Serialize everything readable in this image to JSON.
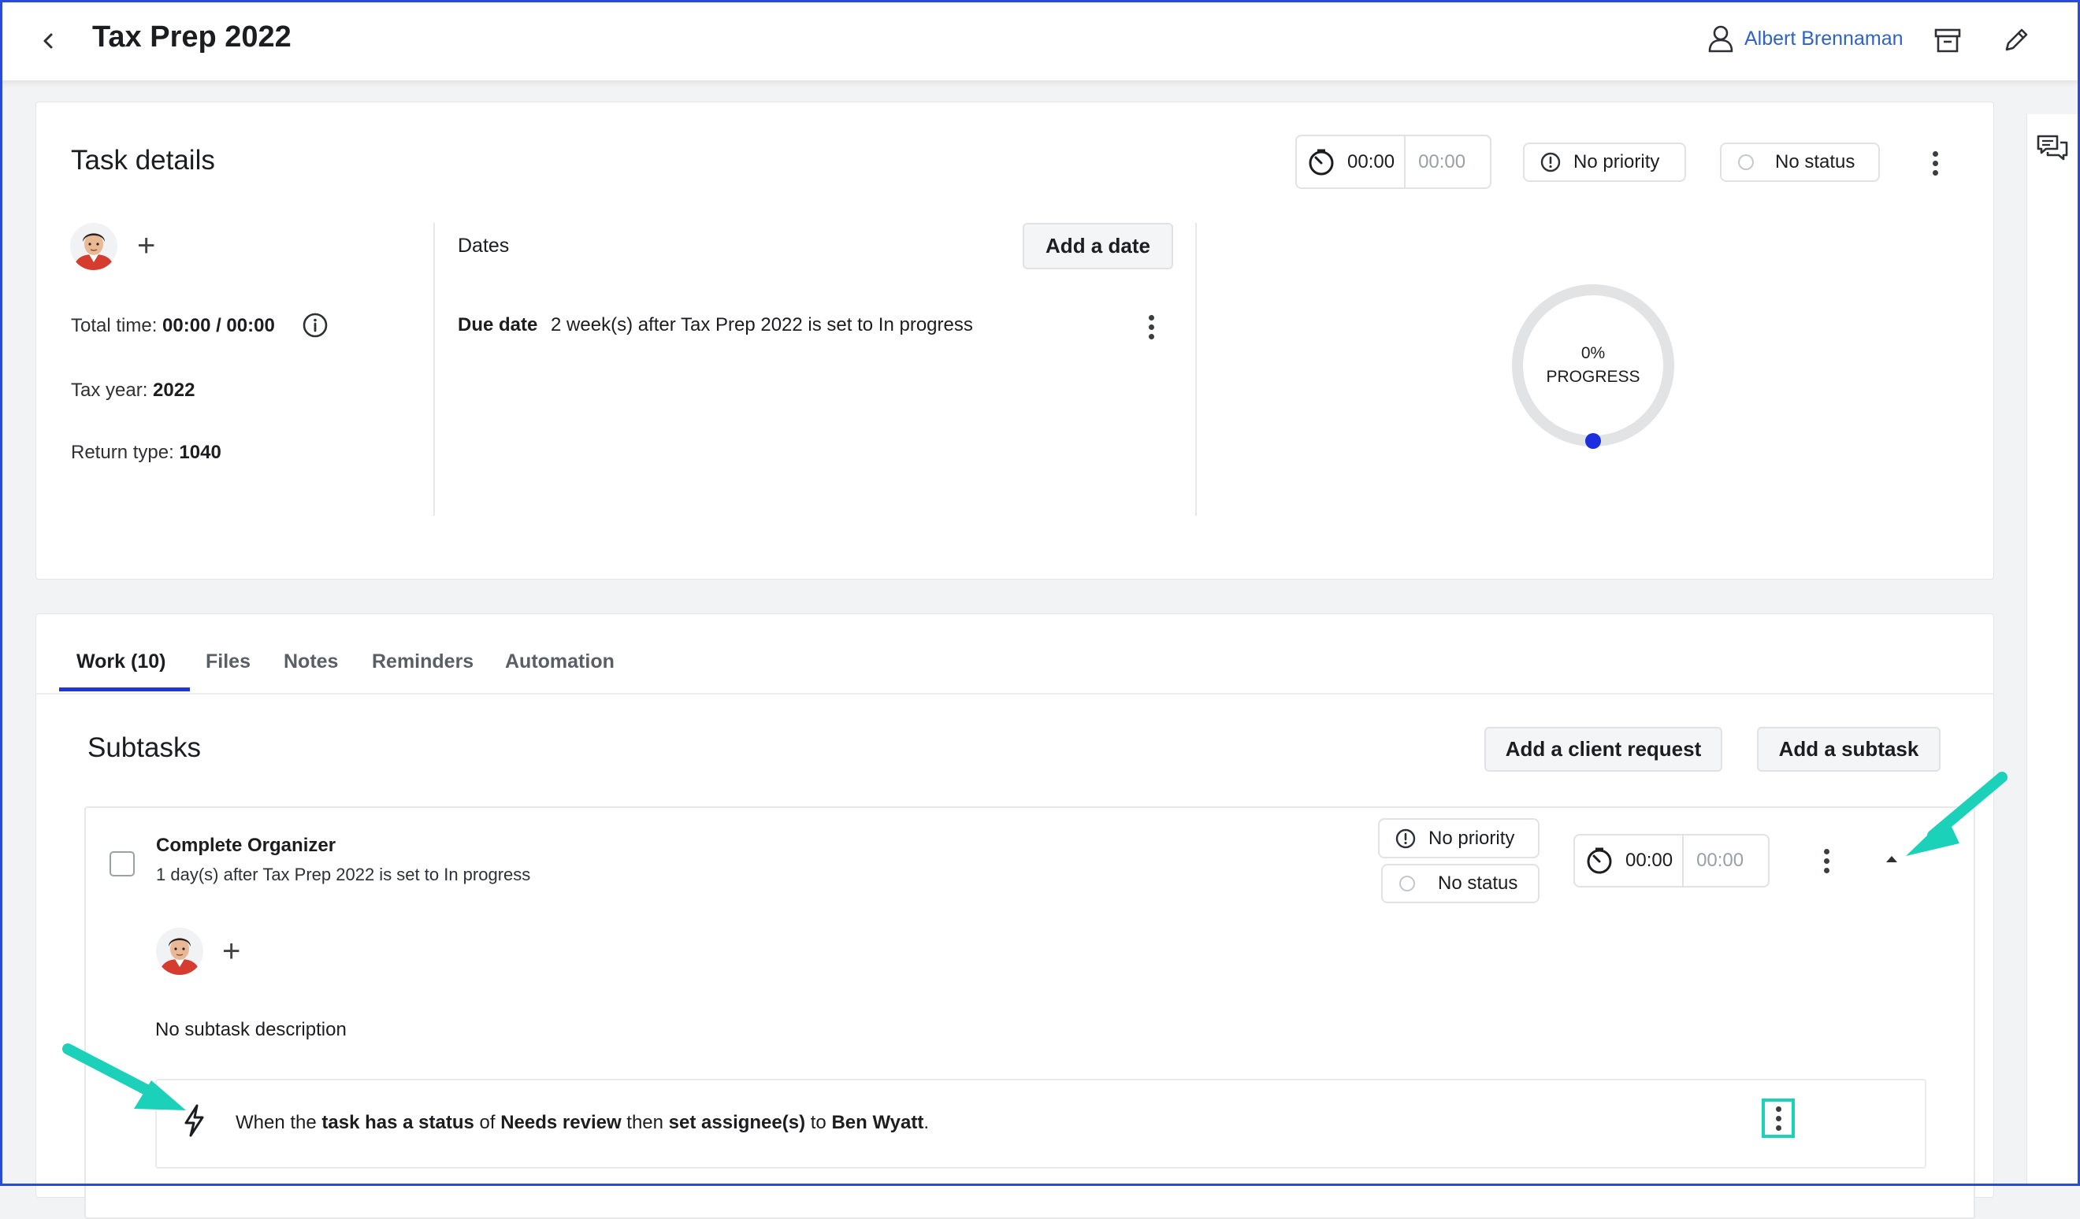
{
  "header": {
    "title": "Tax Prep 2022",
    "user_name": "Albert Brennaman"
  },
  "task_details": {
    "title": "Task details",
    "timer": {
      "elapsed": "00:00",
      "estimate": "00:00"
    },
    "priority": "No priority",
    "status": "No status",
    "total_time_label": "Total time:",
    "total_time_value": "00:00 / 00:00",
    "tax_year_label": "Tax year:",
    "tax_year_value": "2022",
    "return_type_label": "Return type:",
    "return_type_value": "1040",
    "dates_label": "Dates",
    "add_date_label": "Add a date",
    "due_date_label": "Due date",
    "due_date_value": "2 week(s) after Tax Prep 2022 is set to In progress",
    "progress": {
      "value": 0,
      "percent_label": "0%",
      "label": "PROGRESS"
    }
  },
  "tabs": [
    {
      "label": "Work  (10)",
      "active": true
    },
    {
      "label": "Files",
      "active": false
    },
    {
      "label": "Notes",
      "active": false
    },
    {
      "label": "Reminders",
      "active": false
    },
    {
      "label": "Automation",
      "active": false
    }
  ],
  "subtasks": {
    "title": "Subtasks",
    "add_client_request_label": "Add a client request",
    "add_subtask_label": "Add a subtask",
    "item": {
      "title": "Complete Organizer",
      "subtitle": "1 day(s) after Tax Prep 2022 is set to In progress",
      "priority": "No priority",
      "status": "No status",
      "timer": {
        "elapsed": "00:00",
        "estimate": "00:00"
      },
      "description": "No subtask description",
      "automation": {
        "p1": "When the ",
        "b1": "task has a status",
        "p2": " of ",
        "b2": "Needs review",
        "p3": " then ",
        "b3": "set assignee(s)",
        "p4": " to ",
        "b4": "Ben Wyatt",
        "p5": "."
      }
    }
  },
  "colors": {
    "accent": "#2235d4",
    "link": "#2f62c6",
    "annotation_arrow": "#1cd1b9",
    "frame": "#2a4bd7"
  },
  "icons": [
    "back-chevron-icon",
    "user-icon",
    "archive-icon",
    "pencil-icon",
    "comments-icon",
    "timer-icon",
    "priority-icon",
    "status-circle-icon",
    "info-icon",
    "plus-icon",
    "kebab-icon",
    "lightning-icon",
    "caret-up-icon"
  ]
}
